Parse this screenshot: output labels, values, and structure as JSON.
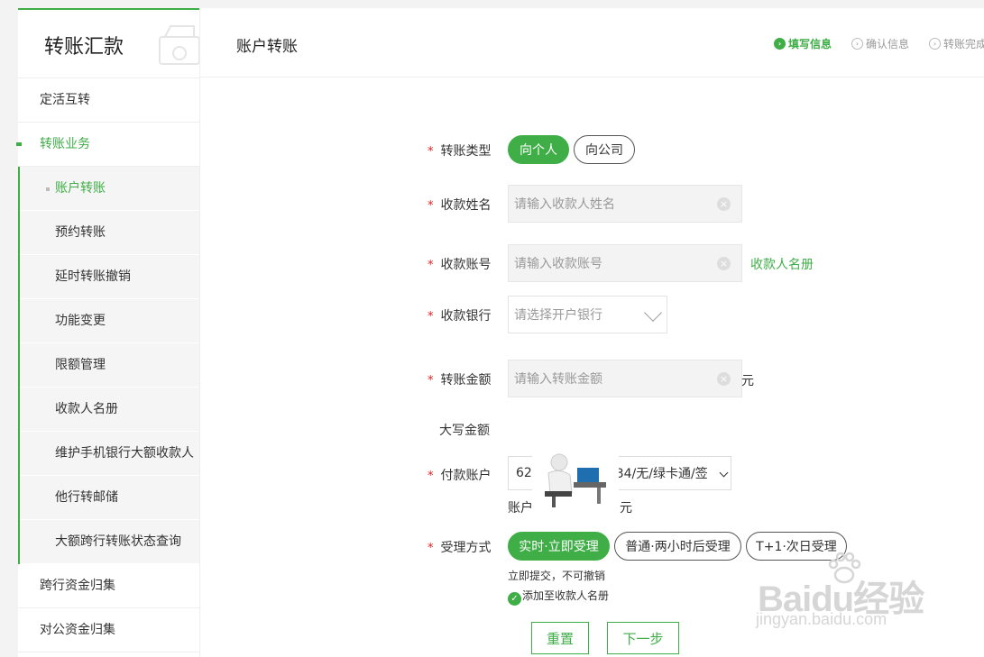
{
  "sidebar": {
    "title": "转账汇款",
    "items": [
      {
        "label": "定活互转"
      },
      {
        "label": "转账业务"
      }
    ],
    "sub_items": [
      {
        "label": "账户转账"
      },
      {
        "label": "预约转账"
      },
      {
        "label": "延时转账撤销"
      },
      {
        "label": "功能变更"
      },
      {
        "label": "限额管理"
      },
      {
        "label": "收款人名册"
      },
      {
        "label": "维护手机银行大额收款人"
      },
      {
        "label": "他行转邮储"
      },
      {
        "label": "大额跨行转账状态查询"
      }
    ],
    "bottom_items": [
      {
        "label": "跨行资金归集"
      },
      {
        "label": "对公资金归集"
      }
    ]
  },
  "header": {
    "title": "账户转账",
    "steps": [
      {
        "label": "填写信息",
        "active": true
      },
      {
        "label": "确认信息",
        "active": false
      },
      {
        "label": "转账完成",
        "active": false
      }
    ]
  },
  "form": {
    "required_mark": "*",
    "transfer_type": {
      "label": "转账类型",
      "options": [
        "向个人",
        "向公司"
      ],
      "selected": "向个人"
    },
    "payee_name": {
      "label": "收款姓名",
      "placeholder": "请输入收款人姓名"
    },
    "payee_account": {
      "label": "收款账号",
      "placeholder": "请输入收款账号",
      "link": "收款人名册"
    },
    "payee_bank": {
      "label": "收款银行",
      "placeholder": "请选择开户银行"
    },
    "amount": {
      "label": "转账金额",
      "placeholder": "请输入转账金额",
      "unit": "元"
    },
    "amount_upper": {
      "label": "大写金额"
    },
    "payer_account": {
      "label": "付款账户",
      "value_prefix": "62",
      "value_suffix": "934/无/绿卡通/签",
      "balance_prefix": "账户",
      "balance_unit": "元"
    },
    "process_mode": {
      "label": "受理方式",
      "options": [
        "实时·立即受理",
        "普通·两小时后受理",
        "T+1·次日受理"
      ],
      "selected": "实时·立即受理",
      "hint": "立即提交，不可撤销"
    },
    "add_to_book": {
      "label": "添加至收款人名册",
      "checked": true
    },
    "buttons": {
      "reset": "重置",
      "next": "下一步"
    }
  },
  "watermark": {
    "brand": "Baidu经验",
    "url": "jingyan.baidu.com"
  },
  "colors": {
    "accent": "#3fae47",
    "required": "#e02020"
  }
}
